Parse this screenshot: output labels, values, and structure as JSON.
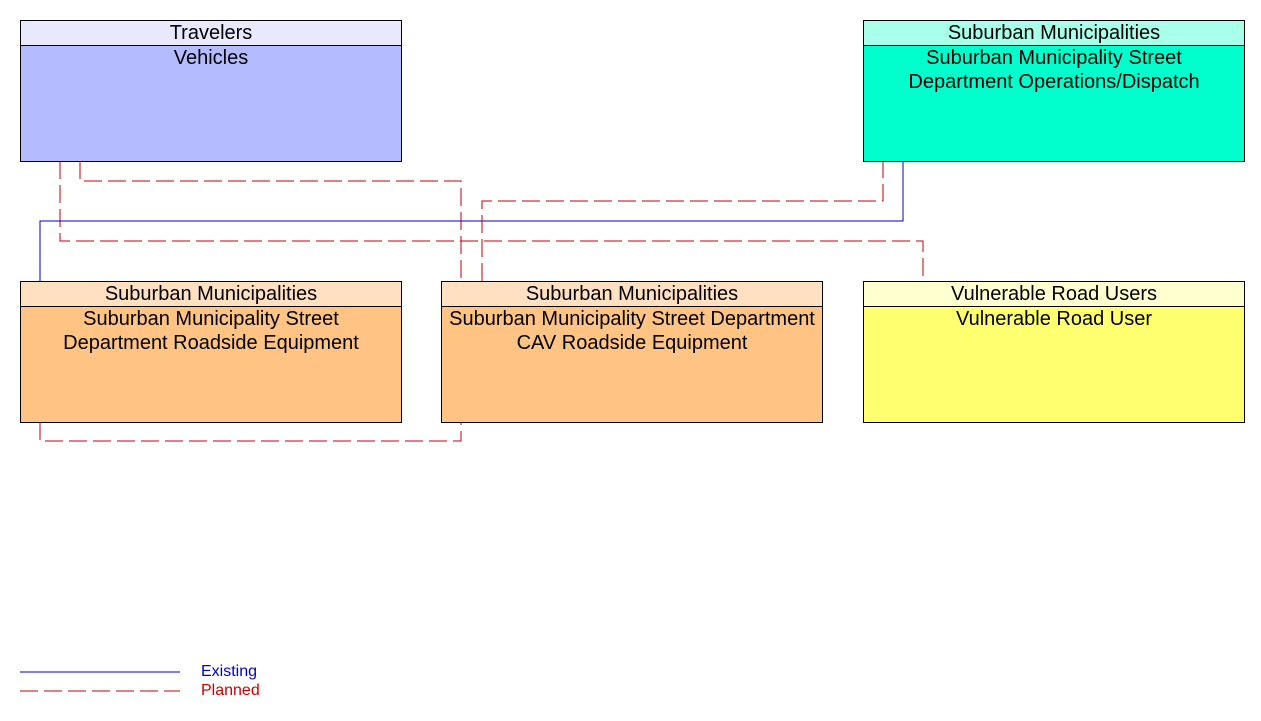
{
  "nodes": [
    {
      "id": "vehicles",
      "group": "Travelers",
      "name": "Vehicles",
      "header_color": "#e8e8ff",
      "body_color": "#b4bcff"
    },
    {
      "id": "dispatch",
      "group": "Suburban Municipalities",
      "name": "Suburban Municipality Street Department Operations/Dispatch",
      "header_color": "#a8ffea",
      "body_color": "#00ffcc"
    },
    {
      "id": "rse",
      "group": "Suburban Municipalities",
      "name": "Suburban Municipality Street Department Roadside Equipment",
      "header_color": "#ffe0c0",
      "body_color": "#ffc484"
    },
    {
      "id": "cav",
      "group": "Suburban Municipalities",
      "name": "Suburban Municipality Street Department CAV Roadside Equipment",
      "header_color": "#ffe0c0",
      "body_color": "#ffc484"
    },
    {
      "id": "vru",
      "group": "Vulnerable Road Users",
      "name": "Vulnerable Road User",
      "header_color": "#ffffd0",
      "body_color": "#ffff70"
    }
  ],
  "connections": [
    {
      "from": "vehicles",
      "to": "cav",
      "status": "Planned"
    },
    {
      "from": "vehicles",
      "to": "vru",
      "status": "Planned"
    },
    {
      "from": "rse",
      "to": "dispatch",
      "status": "Existing"
    },
    {
      "from": "cav",
      "to": "dispatch",
      "status": "Planned"
    },
    {
      "from": "rse",
      "to": "cav",
      "status": "Planned"
    }
  ],
  "legend": {
    "existing": {
      "label": "Existing",
      "color": "#0000cc"
    },
    "planned": {
      "label": "Planned",
      "color": "#cc0000"
    }
  }
}
